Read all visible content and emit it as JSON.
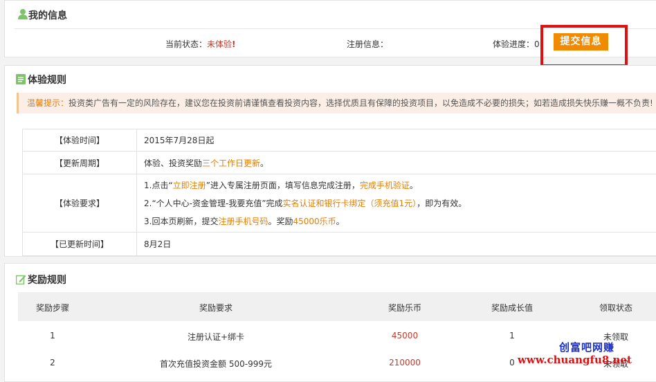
{
  "my_info": {
    "title": "我的信息",
    "status_label": "当前状态：",
    "status_value": "未体验",
    "status_mark": "!",
    "register_label": "注册信息：",
    "progress_label": "体验进度：",
    "progress_value": "0",
    "submit_label": "提交信息"
  },
  "rules": {
    "title": "体验规则",
    "tip_label": "温馨提示：",
    "tip_text": "投资类广告有一定的风险存在，建议您在投资前请谨慎查看投资内容，选择优质且有保障的投资项目，以免造成不必要的损失；如若造成损失快乐赚一概不负责!",
    "time_key": "【体验时间】",
    "time_val": "2015年7月28日起",
    "cycle_key": "【更新周期】",
    "cycle_pre": "体验、投资奖励",
    "cycle_hl": "三个工作日更新",
    "cycle_post": "。",
    "req_key": "【体验要求】",
    "req1": [
      "1.点击“",
      "立即注册",
      "”进入专属注册页面，填写信息完成注册，",
      "完成手机验证",
      "。"
    ],
    "req2": [
      "2.“个人中心-资金管理-我要充值”完成",
      "实名认证和银行卡绑定（须充值1元）",
      "，即为有效。"
    ],
    "req3": [
      "3.回本页刷新，提交",
      "注册手机号码",
      "。奖励",
      "45000乐币",
      "。"
    ],
    "updated_key": "【已更新时间】",
    "updated_val": "8月2日"
  },
  "rewards": {
    "title": "奖励规则",
    "columns": [
      "奖励步骤",
      "奖励要求",
      "奖励乐币",
      "奖励成长值",
      "领取状态"
    ],
    "rows": [
      {
        "step": "1",
        "req": "注册认证+绑卡",
        "coins": "45000",
        "growth": "1",
        "status": "未领取"
      },
      {
        "step": "2",
        "req": "首次充值投资金额 500-999元",
        "coins": "210000",
        "growth": "0",
        "status": "未领取"
      }
    ]
  },
  "watermark": {
    "line1": "创富吧网赚",
    "line2": "www.chuangfu8.net"
  },
  "colors": {
    "accent": "#f08a00",
    "highlight": "#e01010",
    "link": "#e67e00",
    "title_icon": "#7cc36a"
  }
}
